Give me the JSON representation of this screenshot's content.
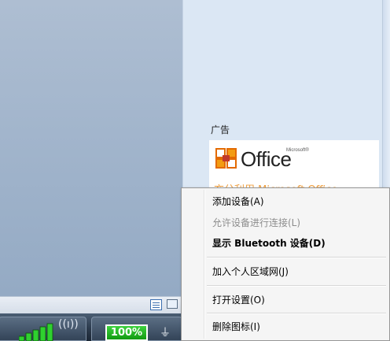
{
  "ad_panel": {
    "label": "广告",
    "office_word": "Office",
    "ms_tag": "Microsoft®",
    "ad_text": "充分利用 Microsoft Office"
  },
  "context_menu": {
    "items": [
      {
        "label": "添加设备(A)",
        "state": "enabled"
      },
      {
        "label": "允许设备进行连接(L)",
        "state": "disabled"
      },
      {
        "label": "显示 Bluetooth 设备(D)",
        "state": "default"
      },
      {
        "label": "加入个人区域网(J)",
        "state": "enabled"
      },
      {
        "label": "打开设置(O)",
        "state": "enabled"
      },
      {
        "label": "删除图标(I)",
        "state": "enabled"
      }
    ]
  },
  "taskbar": {
    "battery_percent": "100%",
    "signal_level": 5,
    "wifi_glyph": "((ı))",
    "plug_glyph": "⏚"
  },
  "colors": {
    "menu_background": "#f5f5f5",
    "battery_green": "#2ab82a",
    "ad_text_orange": "#f0a040",
    "office_logo_orange": "#e36a00"
  },
  "icons": {
    "office_logo": "office-logo-icon",
    "tray_a": "notepad-icon",
    "tray_b": "monitor-icon",
    "signal": "signal-strength-icon",
    "wifi": "wireless-icon",
    "battery": "battery-icon",
    "plug": "power-plug-icon"
  }
}
